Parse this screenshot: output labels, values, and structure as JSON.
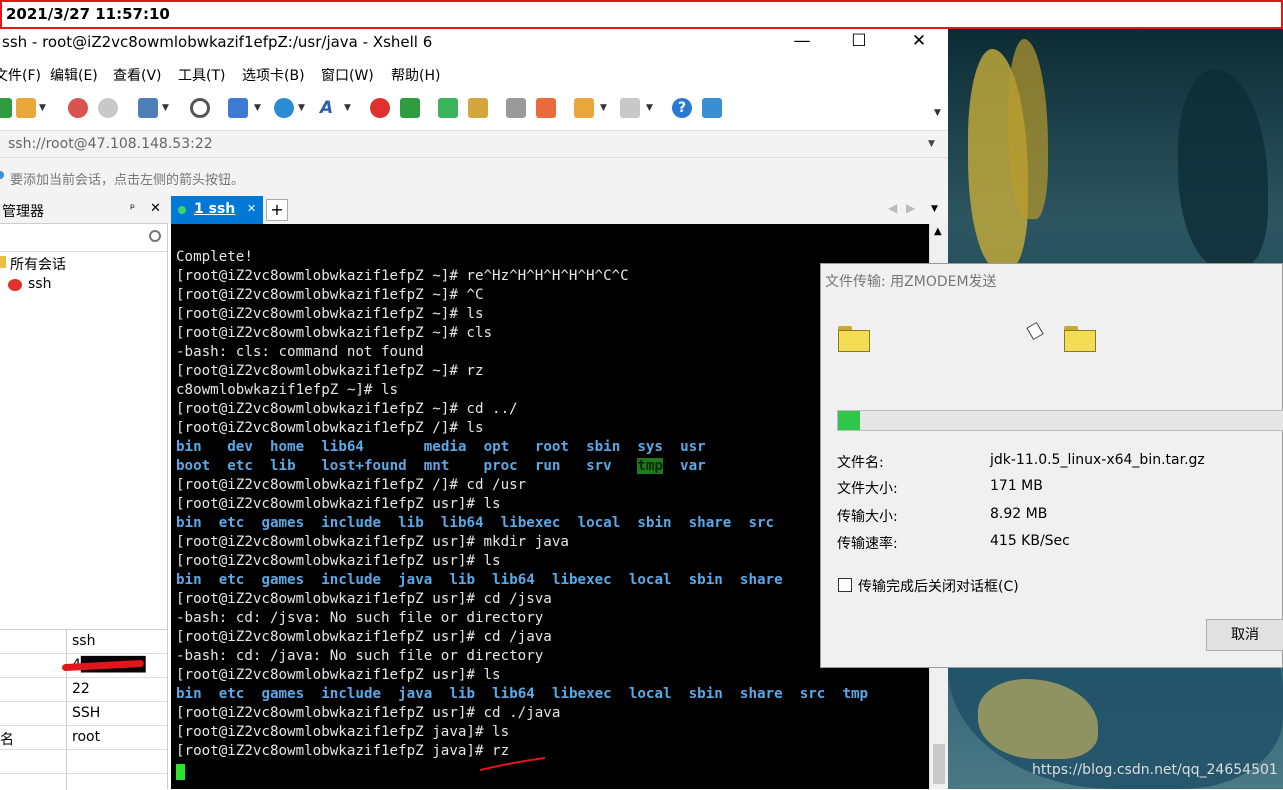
{
  "timestamp": "2021/3/27 11:57:10",
  "window": {
    "title": "ssh - root@iZ2vc8owmlobwkazif1efpZ:/usr/java - Xshell 6",
    "minimize": "—",
    "maximize": "☐",
    "close": "✕"
  },
  "menu": [
    "文件(F)",
    "编辑(E)",
    "查看(V)",
    "工具(T)",
    "选项卡(B)",
    "窗口(W)",
    "帮助(H)"
  ],
  "address": "ssh://root@47.108.148.53:22",
  "hint": "要添加当前会话，点击左侧的箭头按钮。",
  "session_panel": {
    "title": "管理器",
    "pin": "ᵖ",
    "close": "✕",
    "tree": [
      "所有会话",
      "ssh"
    ],
    "props": [
      [
        "",
        "ssh"
      ],
      [
        "",
        "4██████"
      ],
      [
        "",
        "22"
      ],
      [
        "",
        "SSH"
      ],
      [
        "名",
        "root"
      ],
      [
        "",
        ""
      ],
      [
        "",
        ""
      ]
    ]
  },
  "tab": {
    "label": "1 ssh",
    "close": "✕",
    "add": "+"
  },
  "terminal": [
    "",
    "Complete!",
    "[root@iZ2vc8owmlobwkazif1efpZ ~]# re^Hz^H^H^H^H^H^C^C",
    "[root@iZ2vc8owmlobwkazif1efpZ ~]# ^C",
    "[root@iZ2vc8owmlobwkazif1efpZ ~]# ls",
    "[root@iZ2vc8owmlobwkazif1efpZ ~]# cls",
    "-bash: cls: command not found",
    "[root@iZ2vc8owmlobwkazif1efpZ ~]# rz",
    "c8owmlobwkazif1efpZ ~]# ls",
    "[root@iZ2vc8owmlobwkazif1efpZ ~]# cd ../",
    "[root@iZ2vc8owmlobwkazif1efpZ /]# ls",
    "@@bin   dev  home  lib64       media  opt   root  sbin  sys  usr",
    "@@boot  etc  lib   lost+found  mnt    proc  run   srv   tmp  var",
    "[root@iZ2vc8owmlobwkazif1efpZ /]# cd /usr",
    "[root@iZ2vc8owmlobwkazif1efpZ usr]# ls",
    "@@bin  etc  games  include  lib  lib64  libexec  local  sbin  share  src",
    "[root@iZ2vc8owmlobwkazif1efpZ usr]# mkdir java",
    "[root@iZ2vc8owmlobwkazif1efpZ usr]# ls",
    "@@bin  etc  games  include  java  lib  lib64  libexec  local  sbin  share",
    "[root@iZ2vc8owmlobwkazif1efpZ usr]# cd /jsva",
    "-bash: cd: /jsva: No such file or directory",
    "[root@iZ2vc8owmlobwkazif1efpZ usr]# cd /java",
    "-bash: cd: /java: No such file or directory",
    "[root@iZ2vc8owmlobwkazif1efpZ usr]# ls",
    "@@bin  etc  games  include  java  lib  lib64  libexec  local  sbin  share  src  tmp",
    "[root@iZ2vc8owmlobwkazif1efpZ usr]# cd ./java",
    "[root@iZ2vc8owmlobwkazif1efpZ java]# ls",
    "[root@iZ2vc8owmlobwkazif1efpZ java]# rz"
  ],
  "dialog": {
    "title": "文件传输: 用ZMODEM发送",
    "progress": 0.05,
    "fields": [
      [
        "文件名:",
        "jdk-11.0.5_linux-x64_bin.tar.gz"
      ],
      [
        "文件大小:",
        "171 MB"
      ],
      [
        "传输大小:",
        "8.92 MB"
      ],
      [
        "传输速率:",
        "415 KB/Sec"
      ]
    ],
    "checkbox": "传输完成后关闭对话框(C)",
    "cancel": "取消"
  },
  "watermark": "https://blog.csdn.net/qq_24654501",
  "colors": {
    "accent": "#0078d7",
    "dir": "#5aa9e6",
    "progress": "#2fc64a",
    "annotation": "#e0161b"
  }
}
